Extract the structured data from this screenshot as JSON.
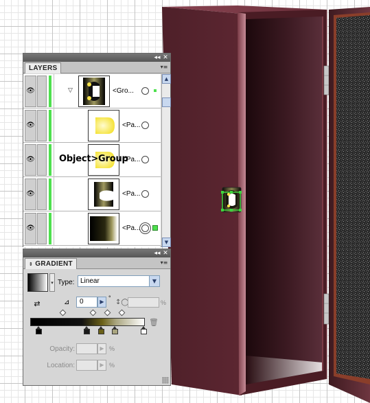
{
  "layers_panel": {
    "title": "LAYERS",
    "menu_icon": "panel-menu-icon",
    "collapse_icon": "collapse-icon",
    "close_icon": "close-icon",
    "annotation": "Object>Group",
    "rows": [
      {
        "name": "<Gro...",
        "expanded": true,
        "selected": true
      },
      {
        "name": "<Pa..."
      },
      {
        "name": "<Pa..."
      },
      {
        "name": "<Pa..."
      },
      {
        "name": "<Pa...",
        "selected": true
      }
    ]
  },
  "gradient_panel": {
    "title": "GRADIENT",
    "type_label": "Type:",
    "type_value": "Linear",
    "angle_value": "0",
    "degree_symbol": "°",
    "percent": "%",
    "opacity_label": "Opacity:",
    "location_label": "Location:",
    "stop_colors": [
      "#000000",
      "#1a1a1a",
      "#6a6018",
      "#a9a57f",
      "#ffffff"
    ]
  },
  "colors": {
    "cabinet": "#5a2730",
    "selection_green": "#4ee04e",
    "panel_bg": "#d6d6d6"
  }
}
